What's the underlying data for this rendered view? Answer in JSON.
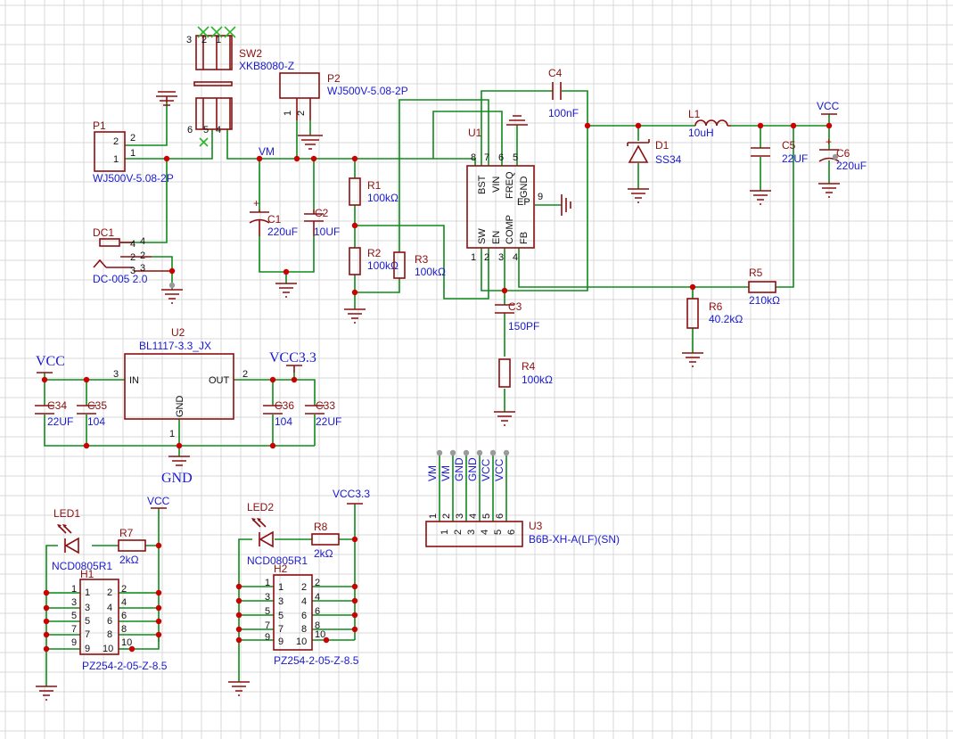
{
  "canvas": {
    "grid_color": "#d9d9d9",
    "wire_color": "#0f8a1a",
    "symbol_color": "#8c0f0f",
    "value_color": "#1a1ad0",
    "junction_color": "#cc0000"
  },
  "nets": {
    "vm": "VM",
    "vcc_right": "VCC",
    "vcc_u2": "VCC",
    "vcc33_u2": "VCC3.3",
    "gnd_u2": "GND",
    "vcc_led": "VCC",
    "vcc33_led": "VCC3.3"
  },
  "sw2": {
    "ref": "SW2",
    "value": "XKB8080-Z",
    "pins_top": [
      "3",
      "2",
      "1"
    ],
    "pins_bottom": [
      "6",
      "5",
      "4"
    ]
  },
  "p1": {
    "ref": "P1",
    "value": "WJ500V-5.08-2P",
    "pins": [
      "2",
      "1"
    ],
    "pins_out": [
      "2",
      "1"
    ]
  },
  "p2": {
    "ref": "P2",
    "value": "WJ500V-5.08-2P",
    "pins": [
      "1",
      "2"
    ]
  },
  "dc1": {
    "ref": "DC1",
    "value": "DC-005 2.0",
    "pins": [
      "4",
      "4",
      "2",
      "2",
      "3",
      "3"
    ]
  },
  "c1": {
    "ref": "C1",
    "value": "220uF"
  },
  "c2": {
    "ref": "C2",
    "value": "10UF"
  },
  "r1": {
    "ref": "R1",
    "value": "100kΩ"
  },
  "r2": {
    "ref": "R2",
    "value": "100kΩ"
  },
  "r3": {
    "ref": "R3",
    "value": "100kΩ"
  },
  "u1": {
    "ref": "U1",
    "top_pins": [
      "8",
      "7",
      "6",
      "5"
    ],
    "top_labels": [
      "BST",
      "VIN",
      "FREQ",
      "GND"
    ],
    "bottom_pins": [
      "1",
      "2",
      "3",
      "4"
    ],
    "bottom_labels": [
      "SW",
      "EN",
      "COMP",
      "FB"
    ],
    "ep_label": "EP",
    "ep_pin": "9"
  },
  "c3": {
    "ref": "C3",
    "value": "150PF"
  },
  "r4": {
    "ref": "R4",
    "value": "100kΩ"
  },
  "c4": {
    "ref": "C4",
    "value": "100nF"
  },
  "l1": {
    "ref": "L1",
    "value": "10uH"
  },
  "d1": {
    "ref": "D1",
    "value": "SS34"
  },
  "c5": {
    "ref": "C5",
    "value": "22UF"
  },
  "c6": {
    "ref": "C6",
    "value": "220uF"
  },
  "r5": {
    "ref": "R5",
    "value": "210kΩ"
  },
  "r6": {
    "ref": "R6",
    "value": "40.2kΩ"
  },
  "u2": {
    "ref": "U2",
    "value": "BL1117-3.3_JX",
    "in_label": "IN",
    "out_label": "OUT",
    "gnd_label": "GND",
    "pin_in": "3",
    "pin_out": "2",
    "pin_gnd": "1"
  },
  "c34": {
    "ref": "C34",
    "value": "22UF"
  },
  "c35": {
    "ref": "C35",
    "value": "104"
  },
  "c36": {
    "ref": "C36",
    "value": "104"
  },
  "c33": {
    "ref": "C33",
    "value": "22UF"
  },
  "u3": {
    "ref": "U3",
    "value": "B6B-XH-A(LF)(SN)",
    "pins": [
      "1",
      "2",
      "3",
      "4",
      "5",
      "6"
    ],
    "net_labels": [
      "VM",
      "VM",
      "GND",
      "GND",
      "VCC",
      "VCC"
    ]
  },
  "led1": {
    "ref": "LED1",
    "value": "NCD0805R1"
  },
  "r7": {
    "ref": "R7",
    "value": "2kΩ"
  },
  "h1": {
    "ref": "H1",
    "value": "PZ254-2-05-Z-8.5",
    "left_pins": [
      "1",
      "3",
      "5",
      "7",
      "9"
    ],
    "right_pins": [
      "2",
      "4",
      "6",
      "8",
      "10"
    ]
  },
  "led2": {
    "ref": "LED2",
    "value": "NCD0805R1"
  },
  "r8": {
    "ref": "R8",
    "value": "2kΩ"
  },
  "h2": {
    "ref": "H2",
    "value": "PZ254-2-05-Z-8.5",
    "left_pins": [
      "1",
      "3",
      "5",
      "7",
      "9"
    ],
    "right_pins": [
      "2",
      "4",
      "6",
      "8",
      "10"
    ]
  }
}
